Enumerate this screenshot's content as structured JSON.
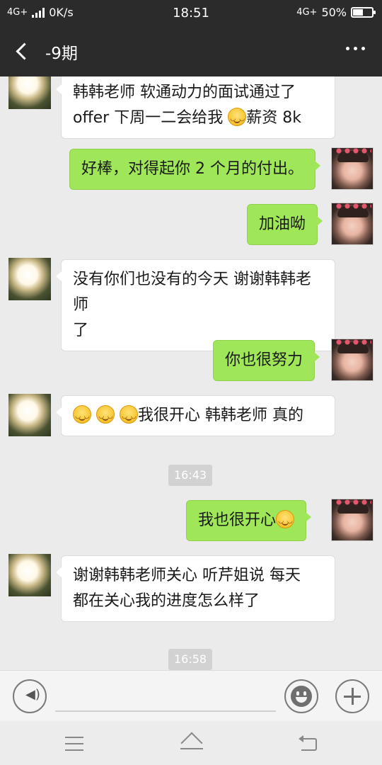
{
  "status_bar": {
    "network_left": "4G+",
    "speed": "0K/s",
    "time": "18:51",
    "network_right": "4G+",
    "battery": "50%",
    "battery_level": 0.5
  },
  "header": {
    "title": "-9期",
    "back_icon": "chevron-left-icon",
    "more_icon": "more-dots-icon"
  },
  "messages": [
    {
      "from": "other",
      "lines": [
        "韩韩老师 软通动力的面试通过了",
        "offer 下周一二会给我"
      ],
      "trail_emoji": 1,
      "trail_text": "薪资 8k"
    },
    {
      "from": "me",
      "text": "好棒，对得起你 2 个月的付出。"
    },
    {
      "from": "me",
      "text": "加油呦"
    },
    {
      "from": "other",
      "lines": [
        "没有你们也没有的今天 谢谢韩韩老师",
        "了"
      ]
    },
    {
      "from": "me",
      "text": "你也很努力"
    },
    {
      "from": "other",
      "lead_emoji": 3,
      "text": "我很开心 韩韩老师 真的"
    },
    {
      "type": "time",
      "text": "16:43"
    },
    {
      "from": "me",
      "text": "我也很开心",
      "trail_emoji": 1
    },
    {
      "from": "other",
      "lines": [
        "谢谢韩韩老师关心 听芹姐说 每天",
        "都在关心我的进度怎么样了"
      ]
    },
    {
      "type": "time",
      "text": "16:58"
    }
  ],
  "input_bar": {
    "voice_icon": "voice-icon",
    "emoji_icon": "emoji-icon",
    "plus_icon": "plus-icon",
    "input_value": ""
  },
  "nav_bar": {
    "menu_icon": "menu-icon",
    "home_icon": "home-icon",
    "back_icon": "back-icon"
  },
  "colors": {
    "header_bg": "#2b2b2b",
    "chat_bg": "#ebebeb",
    "bubble_me": "#9fe658",
    "bubble_other": "#ffffff"
  }
}
